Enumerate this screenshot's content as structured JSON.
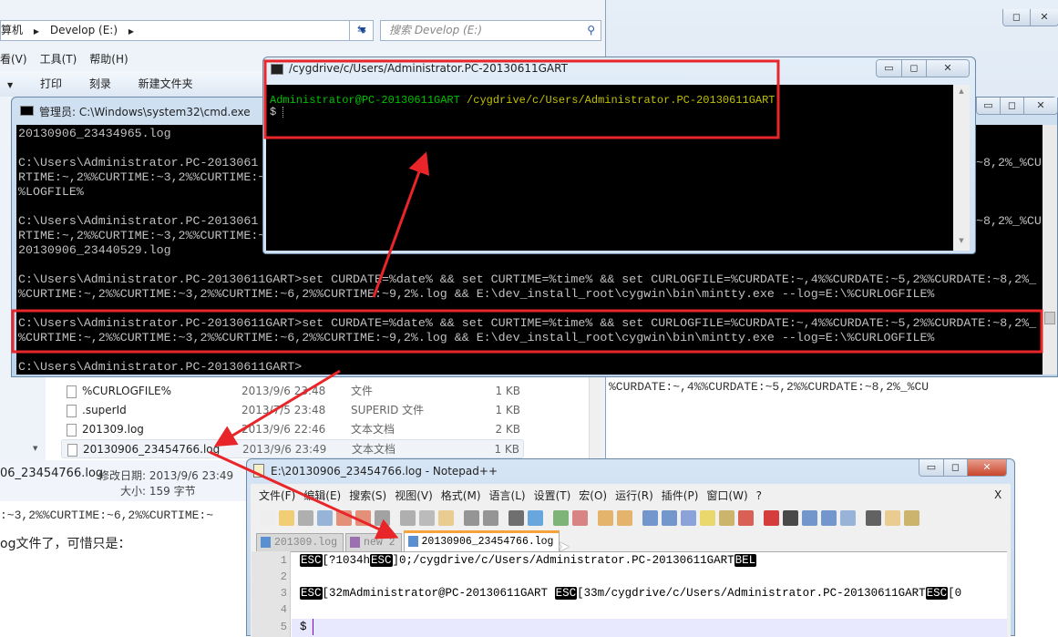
{
  "explorer": {
    "breadcrumb": [
      "算机",
      "Develop (E:)"
    ],
    "search_placeholder": "搜索 Develop (E:)",
    "menu": [
      "看(V)",
      "工具(T)",
      "帮助(H)"
    ],
    "toolbar": [
      "打印",
      "刻录",
      "新建文件夹"
    ],
    "files": [
      {
        "name": "%CURLOGFILE%",
        "date": "2013/9/6 23:48",
        "type": "文件",
        "size": "1 KB"
      },
      {
        "name": ".superId",
        "date": "2013/7/5 23:48",
        "type": "SUPERID 文件",
        "size": "1 KB"
      },
      {
        "name": "201309.log",
        "date": "2013/9/6 22:46",
        "type": "文本文档",
        "size": "2 KB"
      },
      {
        "name": "20130906_23454766.log",
        "date": "2013/9/6 23:49",
        "type": "文本文档",
        "size": "1 KB"
      }
    ],
    "details": {
      "name": "06_23454766.log",
      "modified_label": "修改日期: 2013/9/6 23:49",
      "size_label": "大小: 159 字节"
    }
  },
  "page_text": {
    "right_line": "%CURDATE:~,4%%CURDATE:~5,2%%CURDATE:~8,2%_%CU",
    "left_line1": ":~3,2%%CURTIME:~6,2%%CURTIME:~",
    "left_line2": "og文件了，可惜只是："
  },
  "cmd": {
    "title": "管理员: C:\\Windows\\system32\\cmd.exe",
    "lines": [
      {
        "left": "20130906_23434965.log",
        "right": ""
      },
      {
        "left": "",
        "right": ""
      },
      {
        "left": "C:\\Users\\Administrator.PC-2013061",
        "right": "~8,2%_%CU"
      },
      {
        "left": "RTIME:~,2%%CURTIME:~3,2%%CURTIME:~",
        "right": ""
      },
      {
        "left": "%LOGFILE%",
        "right": ""
      },
      {
        "left": "",
        "right": ""
      },
      {
        "left": "C:\\Users\\Administrator.PC-2013061",
        "right": "~8,2%_%CU"
      },
      {
        "left": "RTIME:~,2%%CURTIME:~3,2%%CURTIME:~",
        "right": ""
      },
      {
        "left": "20130906_23440529.log",
        "right": ""
      },
      {
        "left": "",
        "right": ""
      },
      {
        "left": "C:\\Users\\Administrator.PC-20130611GART>set CURDATE=%date% && set CURTIME=%time% && set CURLOGFILE=%CURDATE:~,4%%CURDATE:~5,2%%CURDATE:~8,2%_",
        "right": ""
      },
      {
        "left": "%CURTIME:~,2%%CURTIME:~3,2%%CURTIME:~6,2%%CURTIME:~9,2%.log && E:\\dev_install_root\\cygwin\\bin\\mintty.exe --log=E:\\%CURLOGFILE%",
        "right": ""
      },
      {
        "left": "",
        "right": ""
      },
      {
        "left": "C:\\Users\\Administrator.PC-20130611GART>set CURDATE=%date% && set CURTIME=%time% && set CURLOGFILE=%CURDATE:~,4%%CURDATE:~5,2%%CURDATE:~8,2%_",
        "right": ""
      },
      {
        "left": "%CURTIME:~,2%%CURTIME:~3,2%%CURTIME:~6,2%%CURTIME:~9,2%.log && E:\\dev_install_root\\cygwin\\bin\\mintty.exe --log=E:\\%CURLOGFILE%",
        "right": ""
      },
      {
        "left": "",
        "right": ""
      },
      {
        "left": "C:\\Users\\Administrator.PC-20130611GART>",
        "right": ""
      }
    ]
  },
  "mintty": {
    "title": "/cygdrive/c/Users/Administrator.PC-20130611GART",
    "user_host": "Administrator@PC-20130611GART",
    "path": "/cygdrive/c/Users/Administrator.PC-20130611GART",
    "prompt": "$"
  },
  "notepad": {
    "title": "E:\\20130906_23454766.log - Notepad++",
    "menu": [
      "文件(F)",
      "编辑(E)",
      "搜索(S)",
      "视图(V)",
      "格式(M)",
      "语言(L)",
      "设置(T)",
      "宏(O)",
      "运行(R)",
      "插件(P)",
      "窗口(W)",
      "?"
    ],
    "close_doc": "X",
    "toolbar_icons": [
      "new-file-icon",
      "open-icon",
      "save-icon",
      "save-all-icon",
      "close-icon",
      "close-all-icon",
      "print-icon",
      "cut-icon",
      "copy-icon",
      "paste-icon",
      "undo-icon",
      "redo-icon",
      "find-icon",
      "replace-icon",
      "zoom-in-icon",
      "zoom-out-icon",
      "sync-v-icon",
      "sync-h-icon",
      "wrap-icon",
      "show-all-chars-icon",
      "indent-guide-icon",
      "udl-icon",
      "doc-map-icon",
      "function-list-icon",
      "record-icon",
      "stop-icon",
      "play-icon",
      "play-multi-icon",
      "save-macro-icon",
      "spellcheck-icon",
      "plugin-a-icon",
      "plugin-b-icon"
    ],
    "tabs": [
      {
        "label": "201309.log",
        "active": false
      },
      {
        "label": "new  2",
        "active": false
      },
      {
        "label": "20130906_23454766.log",
        "active": true
      }
    ],
    "line_numbers": [
      "1",
      "2",
      "3",
      "4",
      "5"
    ],
    "line1": {
      "esc1": "ESC",
      "t1": "[?1034h",
      "esc2": "ESC",
      "t2": "]0;/cygdrive/c/Users/Administrator.PC-20130611GART",
      "bel": "BEL"
    },
    "line3": {
      "esc1": "ESC",
      "t1": "[32mAdministrator@PC-20130611GART ",
      "esc2": "ESC",
      "t2": "[33m/cygdrive/c/Users/Administrator.PC-20130611GART",
      "esc3": "ESC",
      "t3": "[0"
    },
    "line5": "$"
  },
  "colors": {
    "annotation_red": "#e8262a",
    "mintty_green": "#00c000",
    "mintty_yellow": "#c0c000",
    "tab_active": "#f7a33c"
  }
}
